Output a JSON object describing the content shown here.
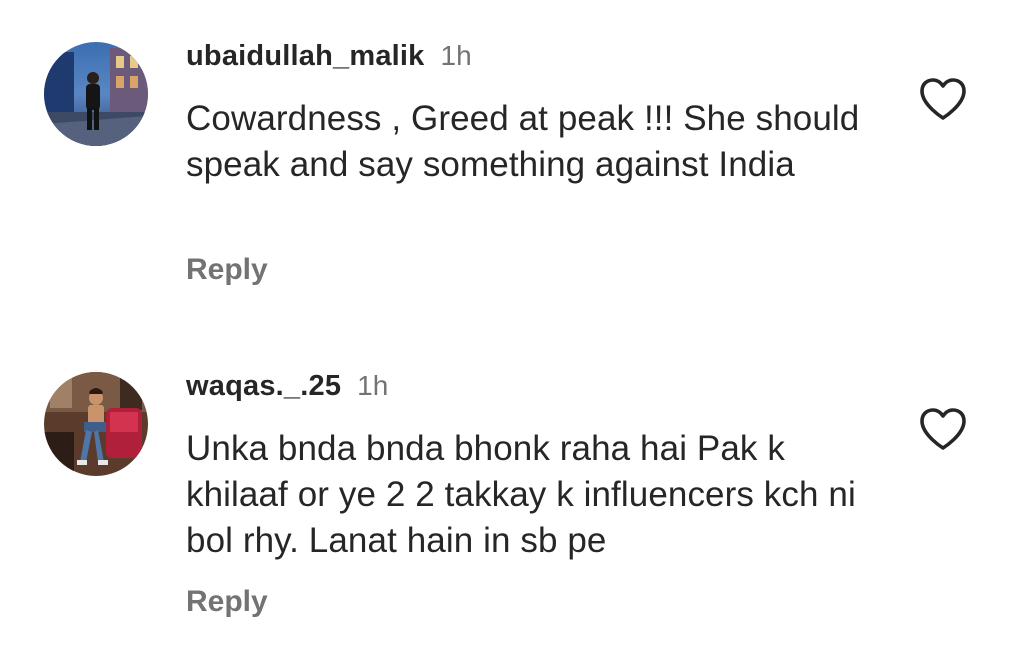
{
  "comments": [
    {
      "username": "ubaidullah_malik",
      "time": "1h",
      "text": "Cowardness , Greed at peak !!! She should speak and say something against India",
      "reply_label": "Reply",
      "like_icon": "heart-outline-icon"
    },
    {
      "username": "waqas._.25",
      "time": "1h",
      "text": "Unka bnda bnda bhonk raha hai Pak k khilaaf or ye 2 2 takkay k influencers kch ni bol rhy. Lanat hain in sb pe",
      "reply_label": "Reply",
      "like_icon": "heart-outline-icon"
    }
  ],
  "colors": {
    "primary_text": "#262626",
    "secondary_text": "#737373",
    "background": "#ffffff"
  }
}
